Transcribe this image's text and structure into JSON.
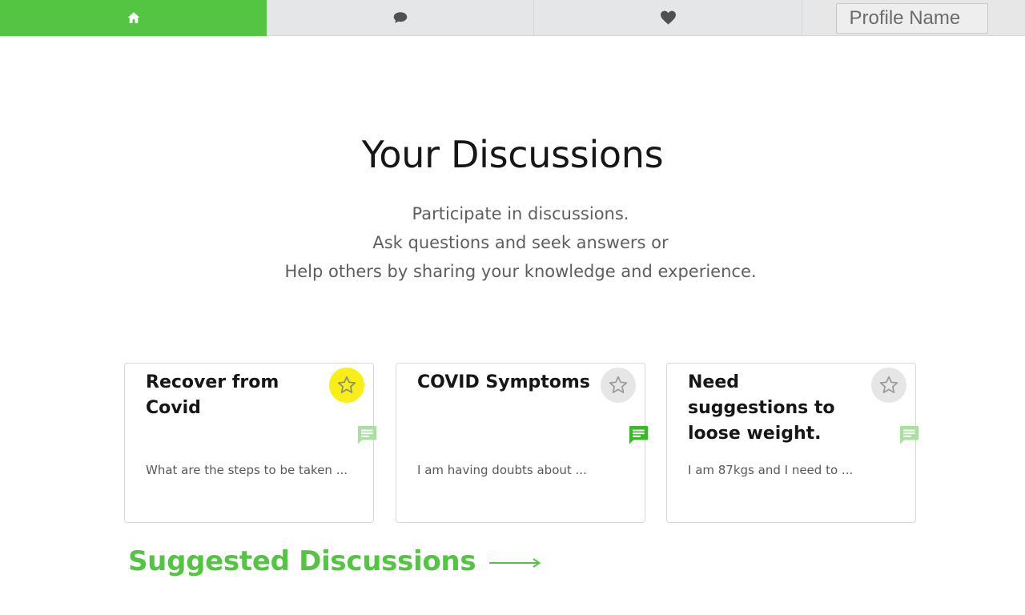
{
  "nav": {
    "tabs": [
      {
        "icon": "home-icon",
        "active": true
      },
      {
        "icon": "chat-bubble-icon",
        "active": false
      },
      {
        "icon": "heart-icon",
        "active": false
      }
    ],
    "profile_placeholder": "Profile Name"
  },
  "hero": {
    "title": "Your Discussions",
    "lines": [
      "Participate in discussions.",
      "Ask questions and seek answers or",
      "Help others by sharing your knowledge and experience."
    ]
  },
  "cards": [
    {
      "title": "Recover from Covid",
      "description": "What are the steps to be taken ...",
      "starred": true
    },
    {
      "title": "COVID Symptoms",
      "description": "I am having doubts about ...",
      "starred": false
    },
    {
      "title": "Need suggestions to loose weight.",
      "description": "I am 87kgs and I need to ...",
      "starred": false
    }
  ],
  "suggested": {
    "label": "Suggested Discussions"
  },
  "colors": {
    "accent": "#54c443",
    "star_active": "#f7ef16",
    "star_inactive_bg": "#e6e6e6",
    "nav_bg": "#e4e6e8"
  }
}
